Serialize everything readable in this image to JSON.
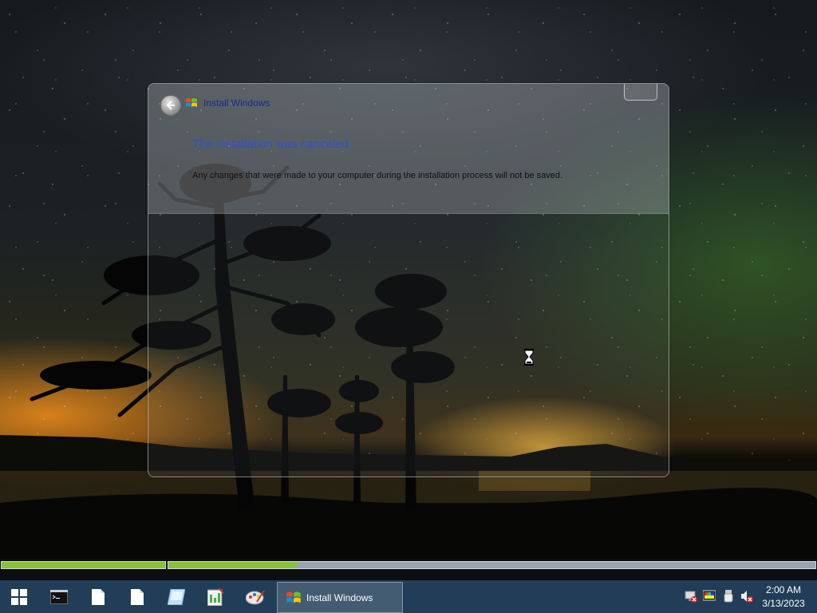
{
  "installer": {
    "title": "Install Windows",
    "heading": "The installation was canceled",
    "message": "Any changes that were made to your computer during the installation process will not be saved."
  },
  "progress": {
    "stage1_fraction": 1.0,
    "stage2_fraction": 0.2
  },
  "taskbar": {
    "items": [
      "start-icon",
      "command-prompt-icon",
      "file-icon",
      "file-icon",
      "disk-icon",
      "notepad-icon",
      "paint-icon"
    ],
    "active_task_label": "Install Windows"
  },
  "tray": {
    "icons": [
      "network-disconnected-icon",
      "display-icon",
      "usb-icon",
      "volume-muted-icon"
    ],
    "time": "2:00 AM",
    "date": "3/13/2023"
  },
  "colors": {
    "taskbar": "#213d57",
    "progress_fill": "#86c23a",
    "heading": "#3050c8",
    "title": "#1a2a8a"
  }
}
